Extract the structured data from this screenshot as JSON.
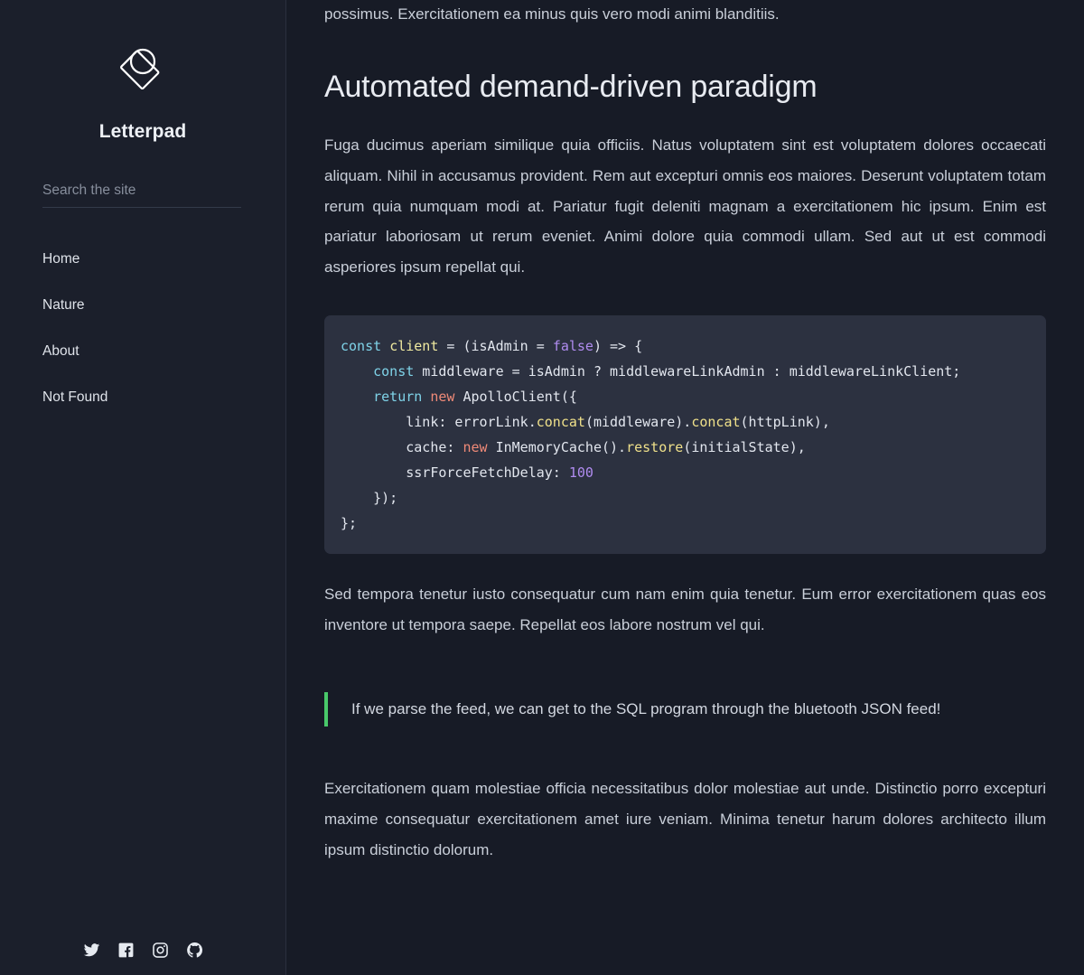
{
  "sidebar": {
    "logo_icon": "letterpad-diamond-logo",
    "brand_name": "Letterpad",
    "search": {
      "placeholder": "Search the site",
      "value": ""
    },
    "nav_items": [
      {
        "label": "Home"
      },
      {
        "label": "Nature"
      },
      {
        "label": "About"
      },
      {
        "label": "Not Found"
      }
    ],
    "social": [
      {
        "name": "twitter",
        "label": "Twitter"
      },
      {
        "name": "facebook",
        "label": "Facebook"
      },
      {
        "name": "instagram",
        "label": "Instagram"
      },
      {
        "name": "github",
        "label": "GitHub"
      }
    ]
  },
  "main": {
    "lead_tail": "possimus. Exercitationem ea minus quis vero modi animi blanditiis.",
    "post_title": "Automated demand-driven paradigm",
    "paragraph_1": "Fuga ducimus aperiam similique quia officiis. Natus voluptatem sint est voluptatem dolores occaecati aliquam. Nihil in accusamus provident. Rem aut excepturi omnis eos maiores. Deserunt voluptatem totam rerum quia numquam modi at. Pariatur fugit deleniti magnam a exercitationem hic ipsum. Enim est pariatur laboriosam ut rerum eveniet. Animi dolore quia commodi ullam. Sed aut ut est commodi asperiores ipsum repellat qui.",
    "code": {
      "language": "javascript",
      "lines": [
        "const client = (isAdmin = false) => {",
        "    const middleware = isAdmin ? middlewareLinkAdmin : middlewareLinkClient;",
        "    return new ApolloClient({",
        "        link: errorLink.concat(middleware).concat(httpLink),",
        "        cache: new InMemoryCache().restore(initialState),",
        "        ssrForceFetchDelay: 100",
        "    });",
        "};"
      ],
      "tokens": {
        "keyword_const": "const",
        "keyword_return": "return",
        "keyword_new": "new",
        "identifier_client": "client",
        "literal_false": "false",
        "number_100": "100",
        "fn_concat": "concat",
        "fn_restore": "restore"
      }
    },
    "paragraph_2": "Sed tempora tenetur iusto consequatur cum nam enim quia tenetur. Eum error exercitationem quas eos inventore ut tempora saepe. Repellat eos labore nostrum vel qui.",
    "quote": "If we parse the feed, we can get to the SQL program through the bluetooth JSON feed!",
    "paragraph_3": "Exercitationem quam molestiae officia necessitatibus dolor molestiae aut unde. Distinctio porro excepturi maxime consequatur exercitationem amet iure veniam. Minima tenetur harum dolores architecto illum ipsum distinctio dolorum."
  },
  "colors": {
    "sidebar_bg": "#1b1f2b",
    "main_bg": "#171b26",
    "code_bg": "#2c3140",
    "quote_accent": "#49c96a",
    "text": "#c9cfd9",
    "heading": "#e8ebf1",
    "code_keyword": "#7fd3e8",
    "code_variable": "#f0eaa0",
    "code_literal": "#b08cf0",
    "code_new": "#f08a78",
    "code_function": "#efe08a"
  }
}
